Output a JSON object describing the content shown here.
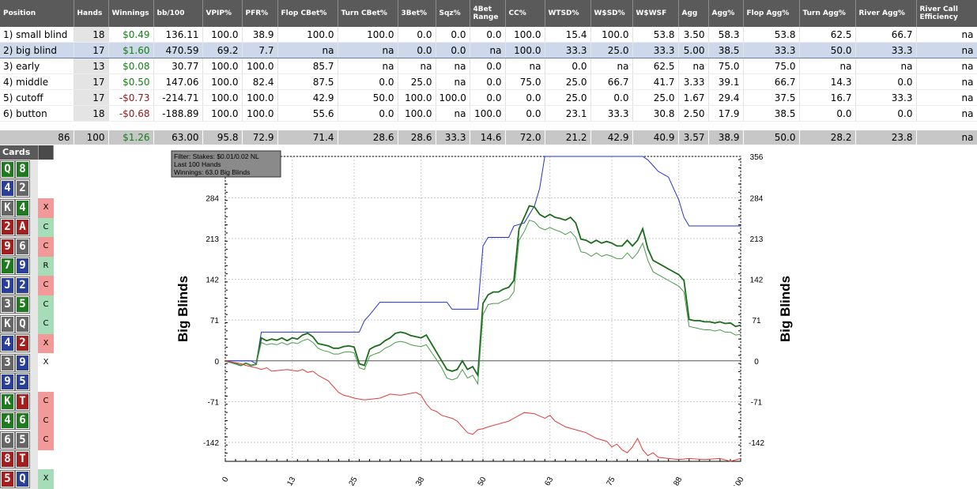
{
  "columns": [
    "Position",
    "Hands",
    "Winnings",
    "bb/100",
    "VPIP%",
    "PFR%",
    "Flop CBet%",
    "Turn CBet%",
    "3Bet%",
    "Sqz%",
    "4Bet Range",
    "CC%",
    "WTSD%",
    "W$SD%",
    "W$WSF",
    "Agg",
    "Agg%",
    "Flop Agg%",
    "Turn Agg%",
    "River Agg%",
    "River Call Efficiency"
  ],
  "rows": [
    [
      "1) small blind",
      "18",
      "$0.49",
      "136.11",
      "100.0",
      "38.9",
      "100.0",
      "100.0",
      "0.0",
      "0.0",
      "0.0",
      "100.0",
      "15.4",
      "100.0",
      "53.8",
      "3.50",
      "58.3",
      "53.8",
      "62.5",
      "66.7",
      "na"
    ],
    [
      "2) big blind",
      "17",
      "$1.60",
      "470.59",
      "69.2",
      "7.7",
      "na",
      "na",
      "0.0",
      "0.0",
      "na",
      "100.0",
      "33.3",
      "25.0",
      "33.3",
      "5.00",
      "38.5",
      "33.3",
      "50.0",
      "33.3",
      "na"
    ],
    [
      "3) early",
      "13",
      "$0.08",
      "30.77",
      "100.0",
      "100.0",
      "85.7",
      "na",
      "na",
      "na",
      "0.0",
      "na",
      "0.0",
      "na",
      "62.5",
      "na",
      "75.0",
      "75.0",
      "na",
      "na",
      "na"
    ],
    [
      "4) middle",
      "17",
      "$0.50",
      "147.06",
      "100.0",
      "82.4",
      "87.5",
      "0.0",
      "25.0",
      "na",
      "0.0",
      "75.0",
      "25.0",
      "66.7",
      "41.7",
      "3.33",
      "39.1",
      "66.7",
      "14.3",
      "0.0",
      "na"
    ],
    [
      "5) cutoff",
      "17",
      "-$0.73",
      "-214.71",
      "100.0",
      "100.0",
      "42.9",
      "50.0",
      "100.0",
      "100.0",
      "0.0",
      "0.0",
      "25.0",
      "0.0",
      "25.0",
      "1.67",
      "29.4",
      "37.5",
      "16.7",
      "33.3",
      "na"
    ],
    [
      "6) button",
      "18",
      "-$0.68",
      "-188.89",
      "100.0",
      "100.0",
      "55.6",
      "0.0",
      "100.0",
      "na",
      "100.0",
      "0.0",
      "23.1",
      "33.3",
      "30.8",
      "2.50",
      "17.9",
      "38.5",
      "0.0",
      "0.0",
      "na"
    ]
  ],
  "totals": [
    "86",
    "100",
    "$1.26",
    "63.00",
    "95.8",
    "72.9",
    "71.4",
    "28.6",
    "28.6",
    "33.3",
    "14.6",
    "72.0",
    "21.2",
    "42.9",
    "40.9",
    "3.57",
    "38.9",
    "50.0",
    "28.2",
    "23.8",
    "na"
  ],
  "cards_header": "Cards",
  "hands": [
    {
      "c1": "Q",
      "s1": "#1f7a1f",
      "c2": "8",
      "s2": "#1f7a1f",
      "action": "",
      "abg": ""
    },
    {
      "c1": "4",
      "s1": "#2a3f9a",
      "c2": "2",
      "s2": "#666666",
      "action": "",
      "abg": ""
    },
    {
      "c1": "K",
      "s1": "#666666",
      "c2": "4",
      "s2": "#1f7a1f",
      "action": "X",
      "abg": "#f29a9a"
    },
    {
      "c1": "2",
      "s1": "#a21f1f",
      "c2": "A",
      "s2": "#a21f1f",
      "action": "C",
      "abg": "#a6dcb8"
    },
    {
      "c1": "9",
      "s1": "#a21f1f",
      "c2": "6",
      "s2": "#666666",
      "action": "C",
      "abg": "#f29a9a"
    },
    {
      "c1": "7",
      "s1": "#1f7a1f",
      "c2": "9",
      "s2": "#2a3f9a",
      "action": "R",
      "abg": "#a6dcb8"
    },
    {
      "c1": "J",
      "s1": "#2a3f9a",
      "c2": "2",
      "s2": "#2a3f9a",
      "action": "C",
      "abg": "#f29a9a"
    },
    {
      "c1": "3",
      "s1": "#666666",
      "c2": "5",
      "s2": "#1f7a1f",
      "action": "C",
      "abg": "#a6dcb8"
    },
    {
      "c1": "K",
      "s1": "#666666",
      "c2": "Q",
      "s2": "#666666",
      "action": "C",
      "abg": "#a6dcb8"
    },
    {
      "c1": "4",
      "s1": "#2a3f9a",
      "c2": "2",
      "s2": "#a21f1f",
      "action": "X",
      "abg": "#f29a9a"
    },
    {
      "c1": "3",
      "s1": "#666666",
      "c2": "9",
      "s2": "#2a3f9a",
      "action": "X",
      "abg": ""
    },
    {
      "c1": "9",
      "s1": "#2a3f9a",
      "c2": "5",
      "s2": "#2a3f9a",
      "action": "",
      "abg": ""
    },
    {
      "c1": "K",
      "s1": "#1f7a1f",
      "c2": "T",
      "s2": "#a21f1f",
      "action": "C",
      "abg": "#f29a9a"
    },
    {
      "c1": "4",
      "s1": "#1f7a1f",
      "c2": "6",
      "s2": "#1f7a1f",
      "action": "C",
      "abg": "#f29a9a"
    },
    {
      "c1": "6",
      "s1": "#666666",
      "c2": "5",
      "s2": "#666666",
      "action": "C",
      "abg": "#f29a9a"
    },
    {
      "c1": "8",
      "s1": "#a21f1f",
      "c2": "T",
      "s2": "#a21f1f",
      "action": "",
      "abg": ""
    },
    {
      "c1": "5",
      "s1": "#a21f1f",
      "c2": "Q",
      "s2": "#2a3f9a",
      "action": "X",
      "abg": "#a6dcb8"
    }
  ],
  "colors": {
    "positive": "#167f16",
    "negative": "#8b1a1a",
    "header_bg": "#5a5a5a"
  },
  "chart_data": {
    "type": "line",
    "info_box": [
      "Filter: Stakes: $0.01/0.02 NL",
      "Last  100 Hands",
      "Winnings: 63.0 Big Blinds"
    ],
    "ylabel_left": "Big Blinds",
    "ylabel_right": "Big Blinds",
    "ylim": [
      -175,
      356
    ],
    "xlim": [
      0,
      100
    ],
    "y_ticks": [
      356,
      284,
      213,
      142,
      71,
      0,
      -71,
      -142
    ],
    "x_ticks": [
      0,
      13,
      25,
      38,
      50,
      63,
      75,
      88,
      100
    ],
    "series": [
      {
        "color": "#2233cc",
        "x": [
          0,
          5,
          6,
          7,
          26,
          27,
          28,
          30,
          43,
          44,
          49,
          50,
          51,
          55,
          56,
          58,
          60,
          61,
          62,
          80,
          81,
          82,
          83,
          84,
          86,
          87,
          88,
          89,
          90,
          100
        ],
        "y": [
          0,
          0,
          -5,
          50,
          50,
          70,
          80,
          102,
          102,
          90,
          90,
          200,
          215,
          215,
          235,
          240,
          270,
          300,
          420,
          420,
          380,
          350,
          340,
          330,
          320,
          300,
          280,
          250,
          235,
          235
        ]
      },
      {
        "color": "#1a6b1a",
        "x": [
          0,
          2,
          3,
          4,
          5,
          6,
          7,
          8,
          9,
          10,
          11,
          12,
          13,
          14,
          15,
          16,
          17,
          18,
          19,
          20,
          21,
          22,
          23,
          24,
          25,
          26,
          27,
          28,
          29,
          30,
          31,
          32,
          33,
          34,
          35,
          36,
          37,
          38,
          39,
          40,
          41,
          42,
          43,
          44,
          45,
          46,
          47,
          48,
          49,
          50,
          51,
          52,
          53,
          54,
          55,
          56,
          57,
          58,
          59,
          60,
          61,
          62,
          63,
          64,
          65,
          66,
          67,
          68,
          69,
          70,
          71,
          72,
          73,
          74,
          75,
          76,
          77,
          78,
          79,
          80,
          81,
          82,
          83,
          84,
          85,
          86,
          87,
          88,
          89,
          90,
          91,
          92,
          93,
          94,
          95,
          96,
          97,
          98,
          99,
          100
        ],
        "y": [
          0,
          -5,
          -8,
          -4,
          -8,
          -6,
          40,
          35,
          38,
          36,
          40,
          35,
          40,
          38,
          45,
          48,
          42,
          30,
          28,
          26,
          22,
          22,
          25,
          26,
          24,
          -5,
          -8,
          20,
          25,
          28,
          35,
          40,
          48,
          50,
          48,
          44,
          42,
          40,
          45,
          30,
          15,
          0,
          -15,
          -18,
          -15,
          0,
          -15,
          -10,
          -25,
          100,
          115,
          120,
          120,
          125,
          128,
          140,
          230,
          250,
          270,
          268,
          255,
          250,
          255,
          250,
          248,
          245,
          250,
          240,
          212,
          210,
          205,
          210,
          205,
          208,
          205,
          200,
          200,
          210,
          200,
          210,
          230,
          195,
          175,
          170,
          165,
          160,
          155,
          150,
          140,
          72,
          70,
          70,
          68,
          68,
          66,
          68,
          65,
          66,
          60,
          62
        ]
      },
      {
        "color": "#4a9a4a",
        "x": [
          0,
          2,
          3,
          4,
          5,
          6,
          7,
          8,
          9,
          10,
          11,
          12,
          13,
          14,
          15,
          16,
          17,
          18,
          19,
          20,
          21,
          22,
          23,
          24,
          25,
          26,
          27,
          28,
          29,
          30,
          31,
          32,
          33,
          34,
          35,
          36,
          37,
          38,
          39,
          40,
          41,
          42,
          43,
          44,
          45,
          46,
          47,
          48,
          49,
          50,
          51,
          52,
          53,
          54,
          55,
          56,
          57,
          58,
          59,
          60,
          61,
          62,
          63,
          64,
          65,
          66,
          67,
          68,
          69,
          70,
          71,
          72,
          73,
          74,
          75,
          76,
          77,
          78,
          79,
          80,
          81,
          82,
          83,
          84,
          85,
          86,
          87,
          88,
          89,
          90,
          91,
          92,
          93,
          94,
          95,
          96,
          97,
          98,
          99,
          100
        ],
        "y": [
          0,
          -5,
          -8,
          -4,
          -8,
          -6,
          32,
          28,
          30,
          28,
          32,
          28,
          32,
          30,
          35,
          38,
          32,
          22,
          18,
          16,
          12,
          12,
          15,
          16,
          14,
          -12,
          -15,
          8,
          12,
          15,
          22,
          26,
          32,
          34,
          32,
          28,
          26,
          25,
          28,
          15,
          2,
          -12,
          -30,
          -33,
          -30,
          -15,
          -30,
          -25,
          -40,
          80,
          98,
          100,
          100,
          105,
          108,
          120,
          210,
          225,
          245,
          242,
          232,
          228,
          232,
          228,
          225,
          220,
          225,
          215,
          190,
          188,
          182,
          188,
          182,
          185,
          182,
          178,
          178,
          188,
          178,
          188,
          205,
          175,
          155,
          150,
          145,
          140,
          135,
          130,
          120,
          60,
          58,
          56,
          54,
          54,
          52,
          54,
          50,
          50,
          45,
          46
        ]
      },
      {
        "color": "#e03a3a",
        "x": [
          0,
          3,
          4,
          5,
          6,
          7,
          8,
          9,
          12,
          14,
          15,
          16,
          17,
          18,
          19,
          20,
          21,
          22,
          23,
          24,
          25,
          27,
          30,
          32,
          34,
          37,
          38,
          39,
          40,
          41,
          42,
          44,
          45,
          46,
          47,
          48,
          49,
          50,
          51,
          53,
          55,
          56,
          57,
          58,
          60,
          62,
          63,
          64,
          65,
          66,
          68,
          70,
          72,
          74,
          75,
          76,
          77,
          78,
          79,
          80,
          81,
          82,
          83,
          84,
          86,
          88,
          90,
          93,
          96,
          98,
          100
        ],
        "y": [
          0,
          -5,
          -8,
          -10,
          -12,
          -15,
          -12,
          -18,
          -15,
          -18,
          -15,
          -20,
          -18,
          -25,
          -30,
          -35,
          -45,
          -55,
          -60,
          -62,
          -65,
          -68,
          -65,
          -58,
          -60,
          -55,
          -60,
          -75,
          -85,
          -88,
          -95,
          -100,
          -105,
          -115,
          -125,
          -128,
          -120,
          -118,
          -115,
          -110,
          -105,
          -100,
          -95,
          -90,
          -92,
          -100,
          -95,
          -105,
          -110,
          -115,
          -120,
          -125,
          -135,
          -140,
          -150,
          -145,
          -155,
          -160,
          -150,
          -135,
          -155,
          -165,
          -160,
          -168,
          -170,
          -172,
          -170,
          -172,
          -170,
          -175,
          -170
        ]
      }
    ]
  }
}
